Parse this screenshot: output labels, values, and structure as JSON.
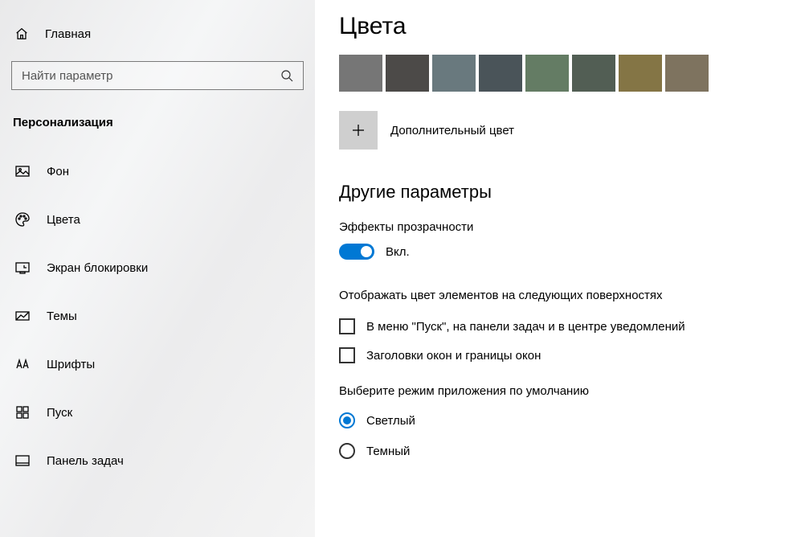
{
  "sidebar": {
    "home_label": "Главная",
    "search_placeholder": "Найти параметр",
    "category_label": "Персонализация",
    "items": [
      {
        "label": "Фон"
      },
      {
        "label": "Цвета"
      },
      {
        "label": "Экран блокировки"
      },
      {
        "label": "Темы"
      },
      {
        "label": "Шрифты"
      },
      {
        "label": "Пуск"
      },
      {
        "label": "Панель задач"
      }
    ]
  },
  "main": {
    "title": "Цвета",
    "swatches": [
      "#767676",
      "#4c4a48",
      "#69797e",
      "#4a5459",
      "#647c64",
      "#525e54",
      "#847545",
      "#7e735f"
    ],
    "custom_color_label": "Дополнительный цвет",
    "section_other": "Другие параметры",
    "transparency_label": "Эффекты прозрачности",
    "toggle_state": "Вкл.",
    "accent_surfaces_label": "Отображать цвет элементов на следующих поверхностях",
    "checkbox1": "В меню \"Пуск\", на панели задач и в центре уведомлений",
    "checkbox2": "Заголовки окон и границы окон",
    "app_mode_label": "Выберите режим приложения по умолчанию",
    "app_mode_light": "Светлый",
    "app_mode_dark": "Темный"
  }
}
